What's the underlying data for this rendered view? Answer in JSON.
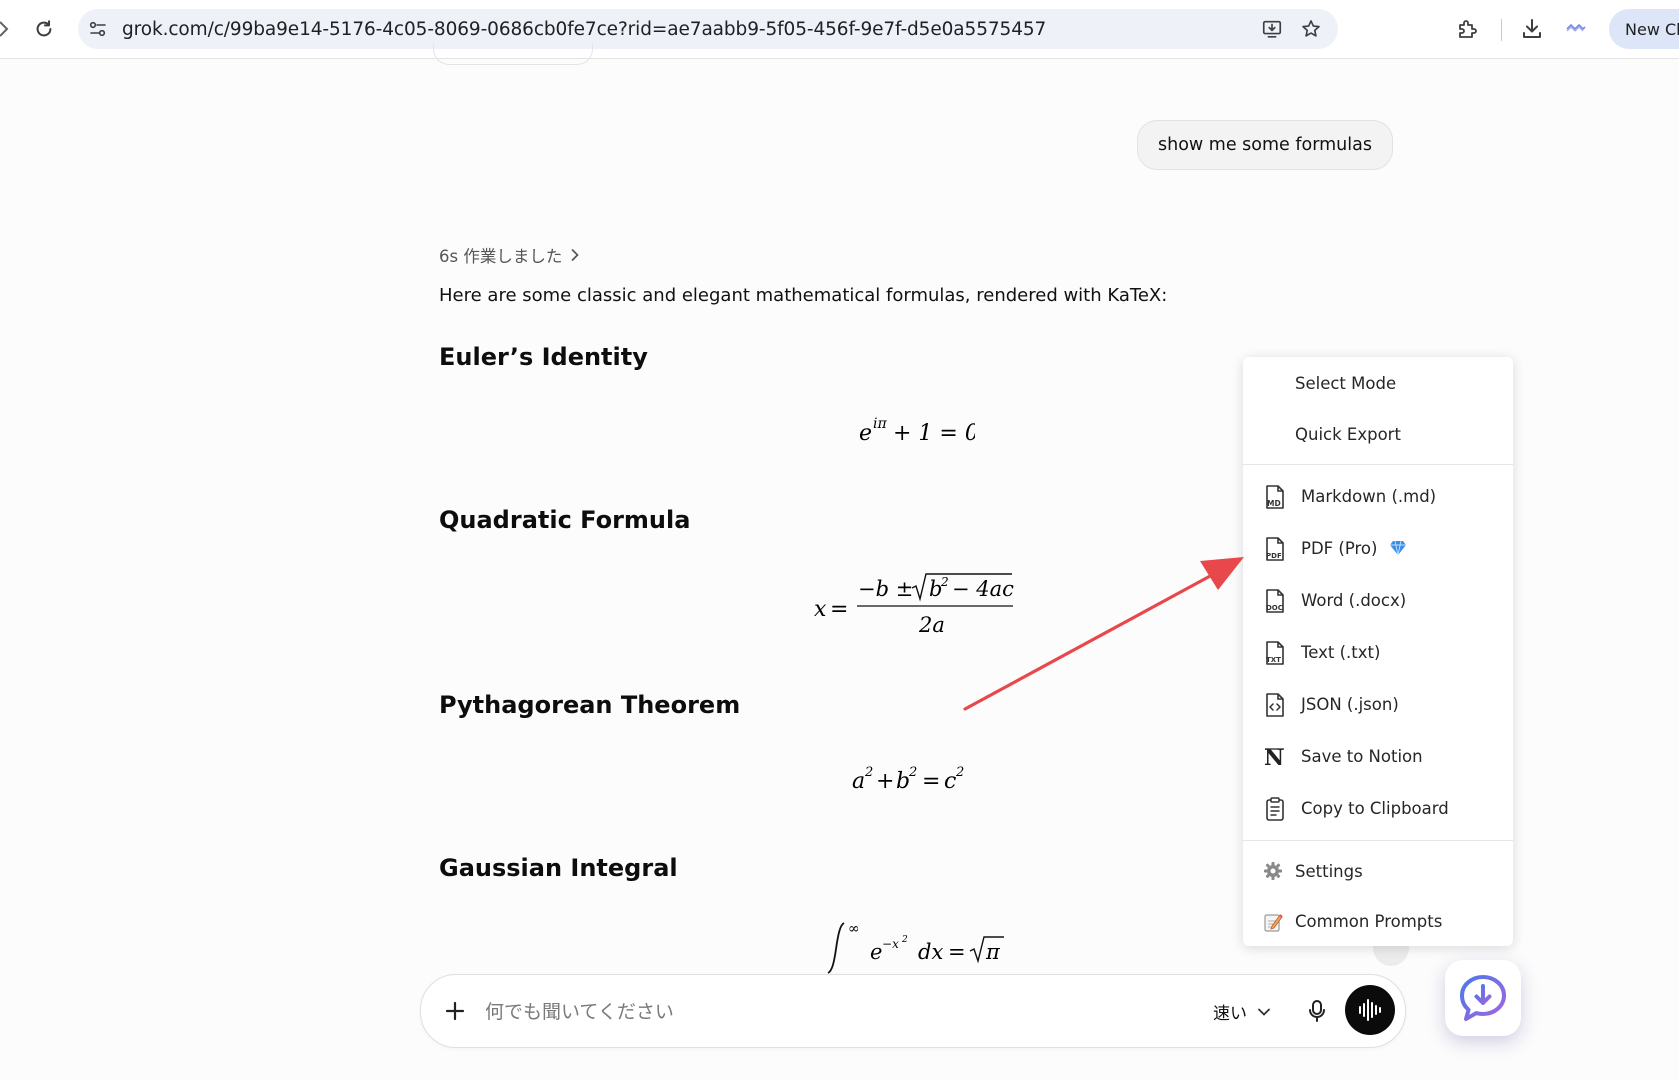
{
  "browser": {
    "url": "grok.com/c/99ba9e14-5176-4c05-8069-0686cb0fe7ce?rid=ae7aabb9-5f05-456f-9e7f-d5e0a5575457",
    "new_chat_label": "New Ch"
  },
  "chat": {
    "user_message": "show me some formulas",
    "thinking_label": "6s 作業しました",
    "intro": "Here are some classic and elegant mathematical formulas, rendered with KaTeX:",
    "sections": [
      {
        "title": "Euler’s Identity"
      },
      {
        "title": "Quadratic Formula"
      },
      {
        "title": "Pythagorean Theorem"
      },
      {
        "title": "Gaussian Integral"
      }
    ]
  },
  "composer": {
    "placeholder": "何でも聞いてください",
    "mode_label": "速い"
  },
  "export_menu": {
    "items": [
      {
        "label": "Select Mode",
        "icon": "none"
      },
      {
        "label": "Quick Export",
        "icon": "none"
      },
      {
        "label": "Markdown (.md)",
        "icon": "md-file-icon"
      },
      {
        "label": "PDF (Pro)",
        "icon": "pdf-file-icon",
        "badge": "gem-icon"
      },
      {
        "label": "Word (.docx)",
        "icon": "doc-file-icon"
      },
      {
        "label": "Text (.txt)",
        "icon": "txt-file-icon"
      },
      {
        "label": "JSON (.json)",
        "icon": "json-file-icon"
      },
      {
        "label": "Save to Notion",
        "icon": "notion-icon"
      },
      {
        "label": "Copy to Clipboard",
        "icon": "clipboard-icon"
      },
      {
        "label": "Settings",
        "icon": "gear-icon"
      },
      {
        "label": "Common Prompts",
        "icon": "memo-icon"
      }
    ]
  },
  "colors": {
    "annotation_arrow": "#e8474c",
    "gem": "#3a8ee6",
    "voice_button": "#0b0b0b"
  }
}
